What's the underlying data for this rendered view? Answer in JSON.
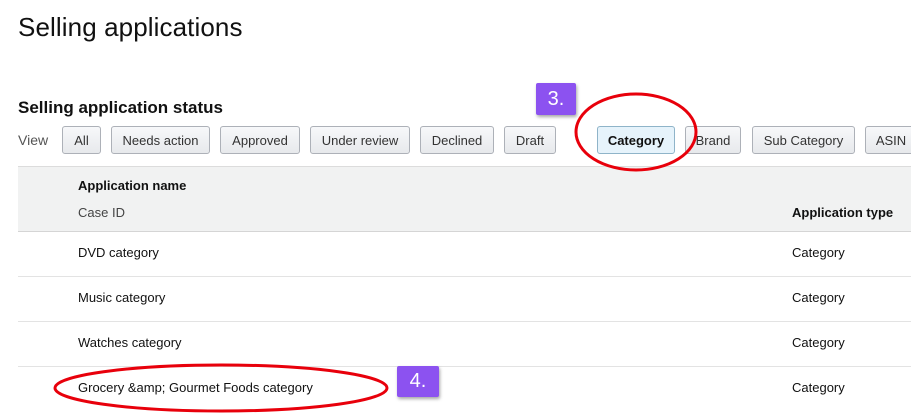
{
  "page": {
    "title": "Selling applications"
  },
  "status_section": {
    "title": "Selling application status",
    "view_label": "View"
  },
  "filters": [
    {
      "label": "All",
      "active": false
    },
    {
      "label": "Needs action",
      "active": false
    },
    {
      "label": "Approved",
      "active": false
    },
    {
      "label": "Under review",
      "active": false
    },
    {
      "label": "Declined",
      "active": false
    },
    {
      "label": "Draft",
      "active": false
    },
    {
      "label": "Category",
      "active": true
    },
    {
      "label": "Brand",
      "active": false
    },
    {
      "label": "Sub Category",
      "active": false
    },
    {
      "label": "ASIN",
      "active": false
    }
  ],
  "table": {
    "headers": {
      "name": "Application name",
      "case_id": "Case ID",
      "type": "Application type"
    },
    "rows": [
      {
        "name": "DVD category",
        "type": "Category"
      },
      {
        "name": "Music category",
        "type": "Category"
      },
      {
        "name": "Watches category",
        "type": "Category"
      },
      {
        "name": "Grocery &amp; Gourmet Foods category",
        "type": "Category"
      }
    ]
  },
  "annotations": {
    "step3": "3.",
    "step4": "4.",
    "badge_color": "#8c52f0",
    "highlight_color": "#e8000b"
  }
}
